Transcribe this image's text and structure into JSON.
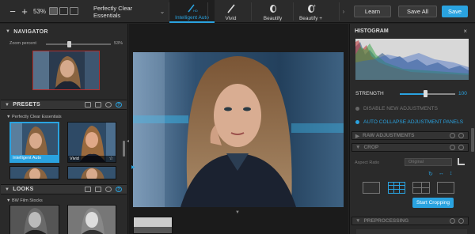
{
  "toolbar": {
    "minus": "−",
    "plus": "+",
    "zoom": "53%",
    "preset_name": "Perfectly Clear Essentials",
    "tabs": [
      {
        "label": "Intelligent Auto",
        "icon": "wand-hd-icon"
      },
      {
        "label": "Vivid",
        "icon": "brush-icon"
      },
      {
        "label": "Beautify",
        "icon": "face-icon"
      },
      {
        "label": "Beautify +",
        "icon": "face-plus-icon"
      }
    ],
    "learn": "Learn",
    "save_all": "Save All",
    "save": "Save"
  },
  "navigator": {
    "title": "NAVIGATOR",
    "zoom_label": "Zoom percent",
    "zoom_value": "53%",
    "zoom_fraction": 0.33
  },
  "presets": {
    "title": "PRESETS",
    "group": "Perfectly Clear Essentials",
    "items": [
      {
        "label": "Intelligent Auto",
        "selected": true
      },
      {
        "label": "Vivid",
        "selected": false
      }
    ]
  },
  "looks": {
    "title": "LOOKS",
    "group": "BW Film Stocks"
  },
  "histogram": {
    "title": "HISTOGRAM",
    "close": "×"
  },
  "strength": {
    "label": "STRENGTH",
    "value": "100",
    "fraction": 0.47
  },
  "options": {
    "disable": "DISABLE NEW ADJUSTMENTS",
    "auto_collapse": "AUTO COLLAPSE ADJUSTMENT PANELS"
  },
  "sections": {
    "raw": "RAW ADJUSTMENTS",
    "crop": "CROP",
    "preprocessing": "PREPROCESSING"
  },
  "crop": {
    "aspect_label": "Aspect Ratio",
    "aspect_value": "Original",
    "start": "Start Cropping"
  },
  "colors": {
    "accent": "#2aa3e0",
    "panel": "#2a2a2a",
    "toolbar": "#2b2b2b"
  }
}
